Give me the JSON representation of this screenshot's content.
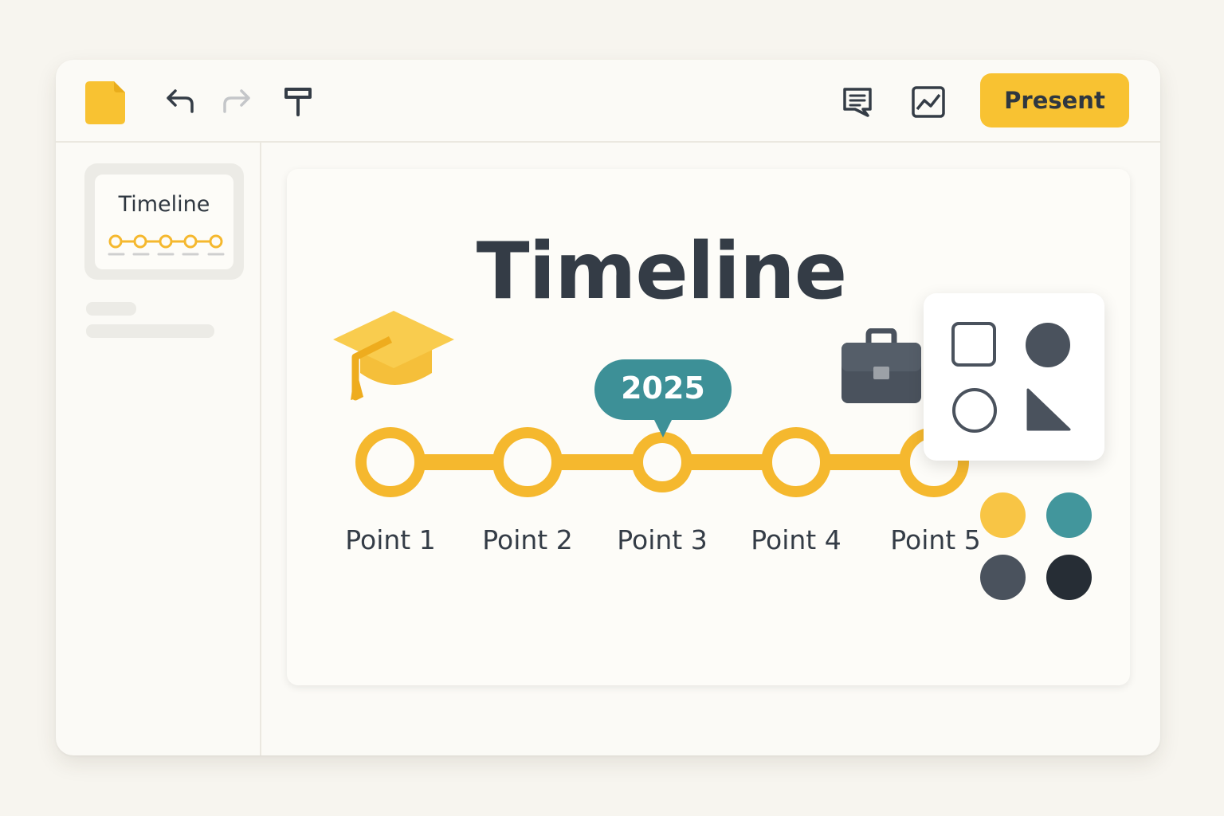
{
  "toolbar": {
    "icons": [
      "document-icon",
      "undo-icon",
      "redo-icon",
      "paint-format-icon",
      "comment-icon",
      "image-icon"
    ],
    "present_label": "Present",
    "accent": "#f8c232"
  },
  "sidebar": {
    "thumbnails": [
      {
        "title": "Timeline",
        "points": 5
      }
    ]
  },
  "slide": {
    "title": "Timeline",
    "icons": [
      "graduation-cap-icon",
      "briefcase-icon"
    ],
    "badge": "2025",
    "points": [
      "Point 1",
      "Point 2",
      "Point 3",
      "Point 4",
      "Point 5"
    ],
    "highlighted_point": 3,
    "timeline_color": "#f5b82e",
    "badge_color": "#3d9097"
  },
  "shapes_panel": {
    "shapes": [
      "square-outline",
      "circle-filled",
      "circle-outline",
      "right-triangle-filled"
    ]
  },
  "palette": {
    "colors": [
      "#f8c545",
      "#42969c",
      "#4a525d",
      "#262d35"
    ]
  }
}
